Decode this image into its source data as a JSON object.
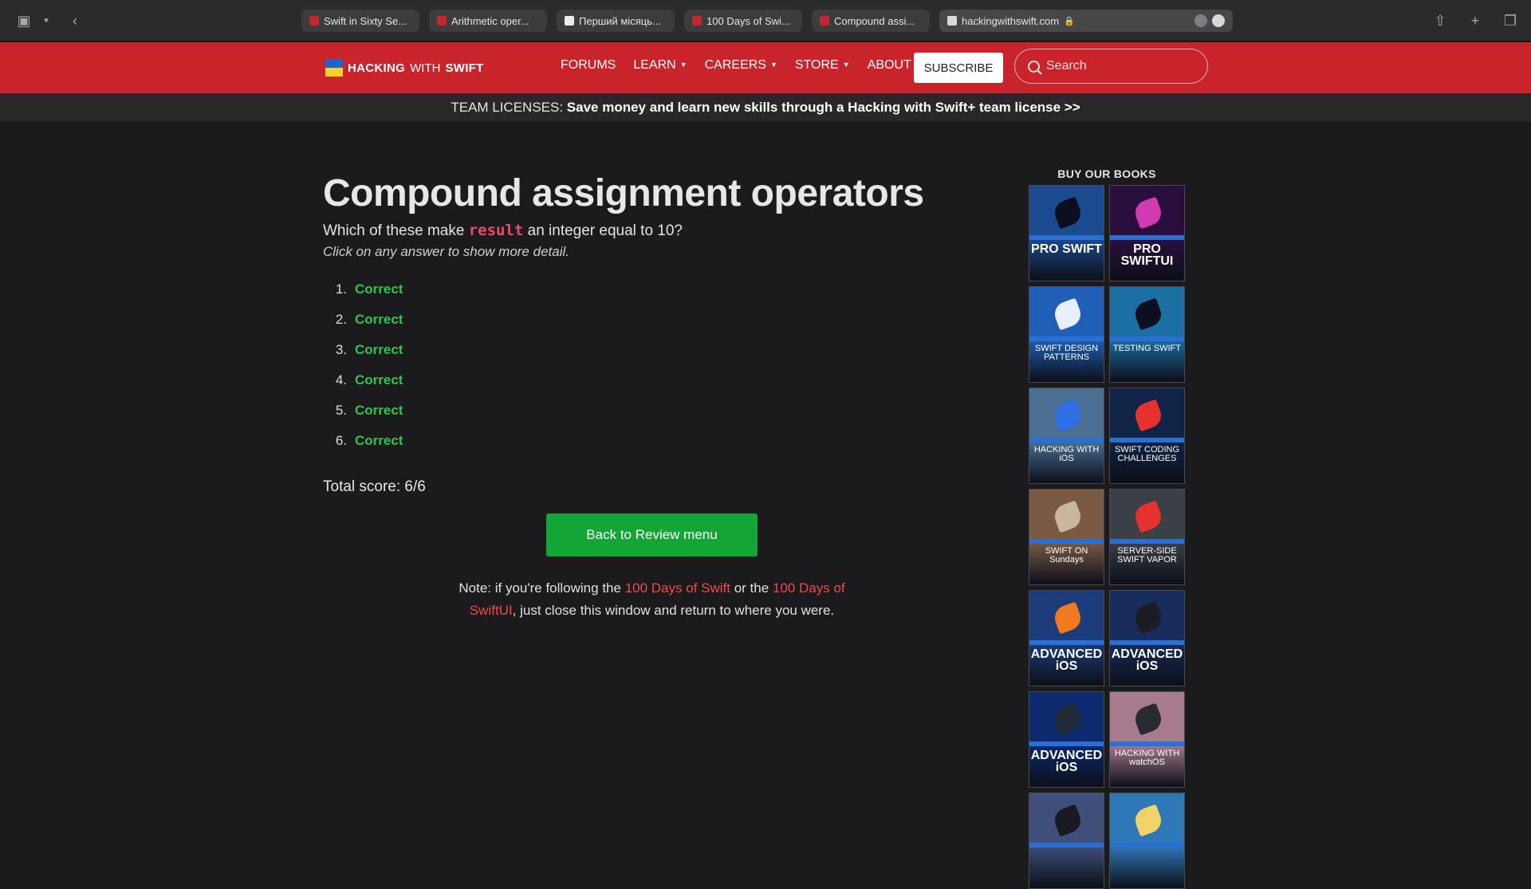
{
  "browser": {
    "tabs": [
      {
        "label": "Swift in Sixty Se..."
      },
      {
        "label": "Arithmetic oper..."
      },
      {
        "label": "Перший місяць..."
      },
      {
        "label": "100 Days of Swi..."
      },
      {
        "label": "Compound assi..."
      }
    ],
    "address": "hackingwithswift.com"
  },
  "header": {
    "logo_bold": "HACKING",
    "logo_mid": "WITH",
    "logo_end": "SWIFT",
    "nav": [
      {
        "label": "FORUMS",
        "dropdown": false
      },
      {
        "label": "LEARN",
        "dropdown": true
      },
      {
        "label": "CAREERS",
        "dropdown": true
      },
      {
        "label": "STORE",
        "dropdown": true
      },
      {
        "label": "ABOUT",
        "dropdown": true
      }
    ],
    "subscribe": "SUBSCRIBE",
    "search_placeholder": "Search"
  },
  "banner": {
    "prefix": "TEAM LICENSES: ",
    "bold": "Save money and learn new skills through a Hacking with Swift+ team license",
    "suffix": " >>"
  },
  "main": {
    "title": "Compound assignment operators",
    "question_before": "Which of these make ",
    "question_code": "result",
    "question_after": " an integer equal to 10?",
    "hint": "Click on any answer to show more detail.",
    "answers": [
      {
        "num": "1.",
        "result": "Correct"
      },
      {
        "num": "2.",
        "result": "Correct"
      },
      {
        "num": "3.",
        "result": "Correct"
      },
      {
        "num": "4.",
        "result": "Correct"
      },
      {
        "num": "5.",
        "result": "Correct"
      },
      {
        "num": "6.",
        "result": "Correct"
      }
    ],
    "score": "Total score: 6/6",
    "back_button": "Back to Review menu",
    "note_1": "Note: if you're following the ",
    "note_link_1": "100 Days of Swift",
    "note_2": " or the ",
    "note_link_2": "100 Days of SwiftUI",
    "note_3": ", just close this window and return to where you were."
  },
  "sidebar": {
    "heading": "BUY OUR BOOKS",
    "books": [
      {
        "title": "PRO SWIFT",
        "bg": "#1c4a8f",
        "accent": "#0b0f1f"
      },
      {
        "title": "PRO SWIFTUI",
        "bg": "#2a0f3e",
        "accent": "#d23ab0"
      },
      {
        "title": "SWIFT DESIGN PATTERNS",
        "bg": "#1f5fb5",
        "accent": "#e8f0ff"
      },
      {
        "title": "TESTING SWIFT",
        "bg": "#1b6fa3",
        "accent": "#0b0f1f"
      },
      {
        "title": "HACKING WITH iOS",
        "bg": "#4a6f93",
        "accent": "#2f6fe6"
      },
      {
        "title": "SWIFT CODING CHALLENGES",
        "bg": "#0f2446",
        "accent": "#e5322d"
      },
      {
        "title": "SWIFT ON Sundays",
        "bg": "#7a5a45",
        "accent": "#c9b69f"
      },
      {
        "title": "SERVER-SIDE SWIFT VAPOR",
        "bg": "#3b3f47",
        "accent": "#e5322d"
      },
      {
        "title": "ADVANCED iOS",
        "bg": "#1b3b7a",
        "accent": "#f07a1d"
      },
      {
        "title": "ADVANCED iOS",
        "bg": "#172c5a",
        "accent": "#1c1c24"
      },
      {
        "title": "ADVANCED iOS",
        "bg": "#0d2a6e",
        "accent": "#222a3a"
      },
      {
        "title": "HACKING WITH watchOS",
        "bg": "#a77a8e",
        "accent": "#2a2a33"
      },
      {
        "title": "",
        "bg": "#3f4f7a",
        "accent": "#1a1a22"
      },
      {
        "title": "",
        "bg": "#2f78b8",
        "accent": "#f1d36a"
      }
    ]
  }
}
